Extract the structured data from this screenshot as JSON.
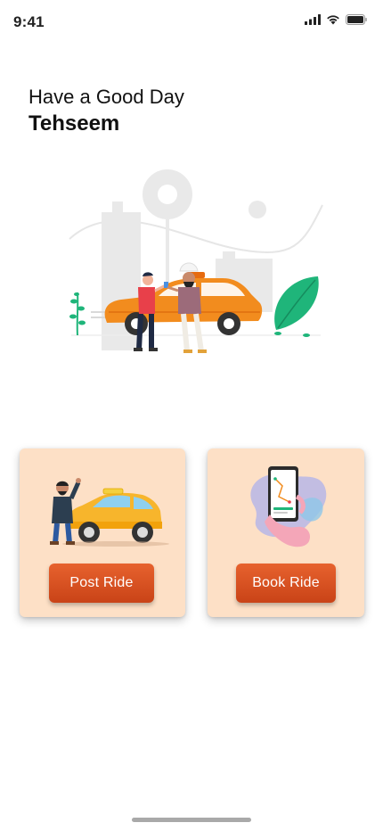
{
  "status_bar": {
    "time": "9:41",
    "icons": [
      "signal-icon",
      "wifi-icon",
      "battery-icon"
    ]
  },
  "header": {
    "greeting": "Have a Good Day",
    "username": "Tehseem"
  },
  "actions": {
    "post_ride": {
      "label": "Post Ride",
      "illustration": "taxi-driver-illustration"
    },
    "book_ride": {
      "label": "Book Ride",
      "illustration": "phone-booking-illustration"
    }
  },
  "colors": {
    "card_background": "#fde0c6",
    "button_gradient_top": "#e7622e",
    "button_gradient_bottom": "#c94317",
    "taxi_orange": "#f28c1e",
    "taxi_yellow": "#f7b52c",
    "plant_green": "#1fb57a"
  }
}
